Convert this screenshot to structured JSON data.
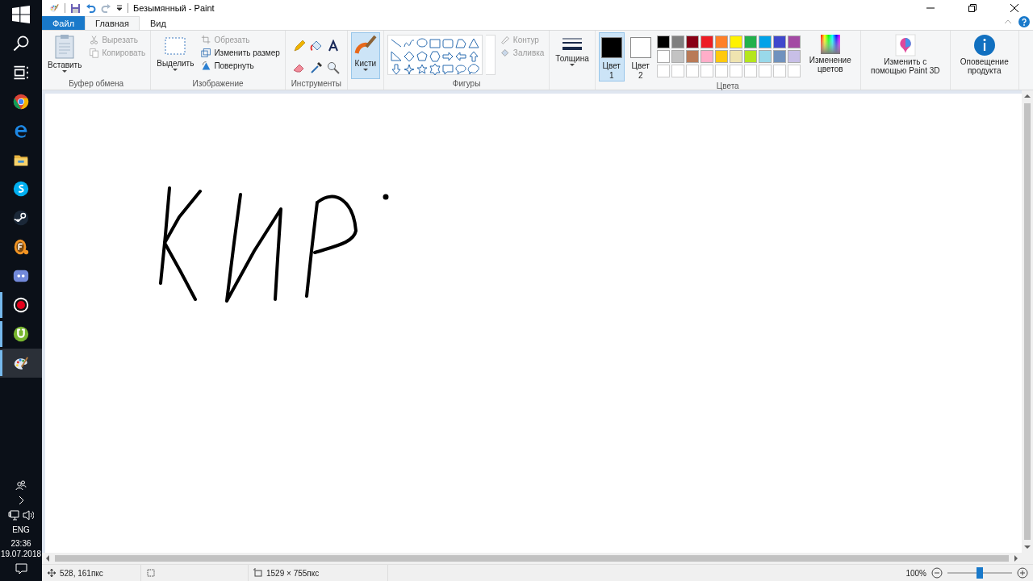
{
  "taskbar": {
    "apps": [
      {
        "running": false,
        "selected": false
      },
      {
        "running": false,
        "selected": false
      },
      {
        "running": false,
        "selected": false
      },
      {
        "running": false,
        "selected": false
      },
      {
        "running": false,
        "selected": false
      },
      {
        "running": false,
        "selected": false
      },
      {
        "running": false,
        "selected": false
      },
      {
        "running": true,
        "selected": false
      },
      {
        "running": true,
        "selected": false
      },
      {
        "running": true,
        "selected": true
      }
    ],
    "language": "ENG",
    "time": "23:36",
    "date": "19.07.2018"
  },
  "window": {
    "title": "Безымянный - Paint"
  },
  "tabs": [
    {
      "label": "Файл",
      "kind": "file",
      "selected": false
    },
    {
      "label": "Главная",
      "kind": "tab",
      "selected": true
    },
    {
      "label": "Вид",
      "kind": "tab",
      "selected": false
    }
  ],
  "clipboard": {
    "label": "Буфер обмена",
    "paste": "Вставить",
    "cut": {
      "label": "Вырезать",
      "disabled": true
    },
    "copy": {
      "label": "Копировать",
      "disabled": true
    }
  },
  "image": {
    "label": "Изображение",
    "select": "Выделить",
    "crop": {
      "label": "Обрезать",
      "disabled": true
    },
    "resize": {
      "label": "Изменить размер",
      "disabled": false
    },
    "rotate": {
      "label": "Повернуть",
      "disabled": false
    }
  },
  "tools": {
    "label": "Инструменты"
  },
  "brushes": {
    "label": "Кисти",
    "selected": true
  },
  "shapes": {
    "label": "Фигуры",
    "outline": {
      "label": "Контур",
      "disabled": true
    },
    "fill": {
      "label": "Заливка",
      "disabled": true
    }
  },
  "size": {
    "label": "Толщина"
  },
  "colors": {
    "label": "Цвета",
    "color1": {
      "label": "Цвет",
      "number": "1",
      "color": "#000000",
      "selected": true
    },
    "color2": {
      "label": "Цвет",
      "number": "2",
      "color": "#ffffff",
      "selected": false
    },
    "palette": [
      {
        "color": "#000000"
      },
      {
        "color": "#7f7f7f"
      },
      {
        "color": "#880015"
      },
      {
        "color": "#ed1c24"
      },
      {
        "color": "#ff7f27"
      },
      {
        "color": "#fff200"
      },
      {
        "color": "#22b14c"
      },
      {
        "color": "#00a2e8"
      },
      {
        "color": "#3f48cc"
      },
      {
        "color": "#a349a4"
      },
      {
        "color": "#ffffff"
      },
      {
        "color": "#c3c3c3"
      },
      {
        "color": "#b97a57"
      },
      {
        "color": "#ffaec9"
      },
      {
        "color": "#ffc90e"
      },
      {
        "color": "#efe4b0"
      },
      {
        "color": "#b5e61d"
      },
      {
        "color": "#99d9ea"
      },
      {
        "color": "#7092be"
      },
      {
        "color": "#c8bfe7"
      }
    ],
    "edit": "Изменение цветов"
  },
  "paint3d": "Изменить с помощью Paint 3D",
  "notification": "Оповещение продукта",
  "status_bar": {
    "position": "528, 161пкс",
    "dimensions": "1529 × 755пкс",
    "zoom": "100%",
    "level": 0.5
  }
}
